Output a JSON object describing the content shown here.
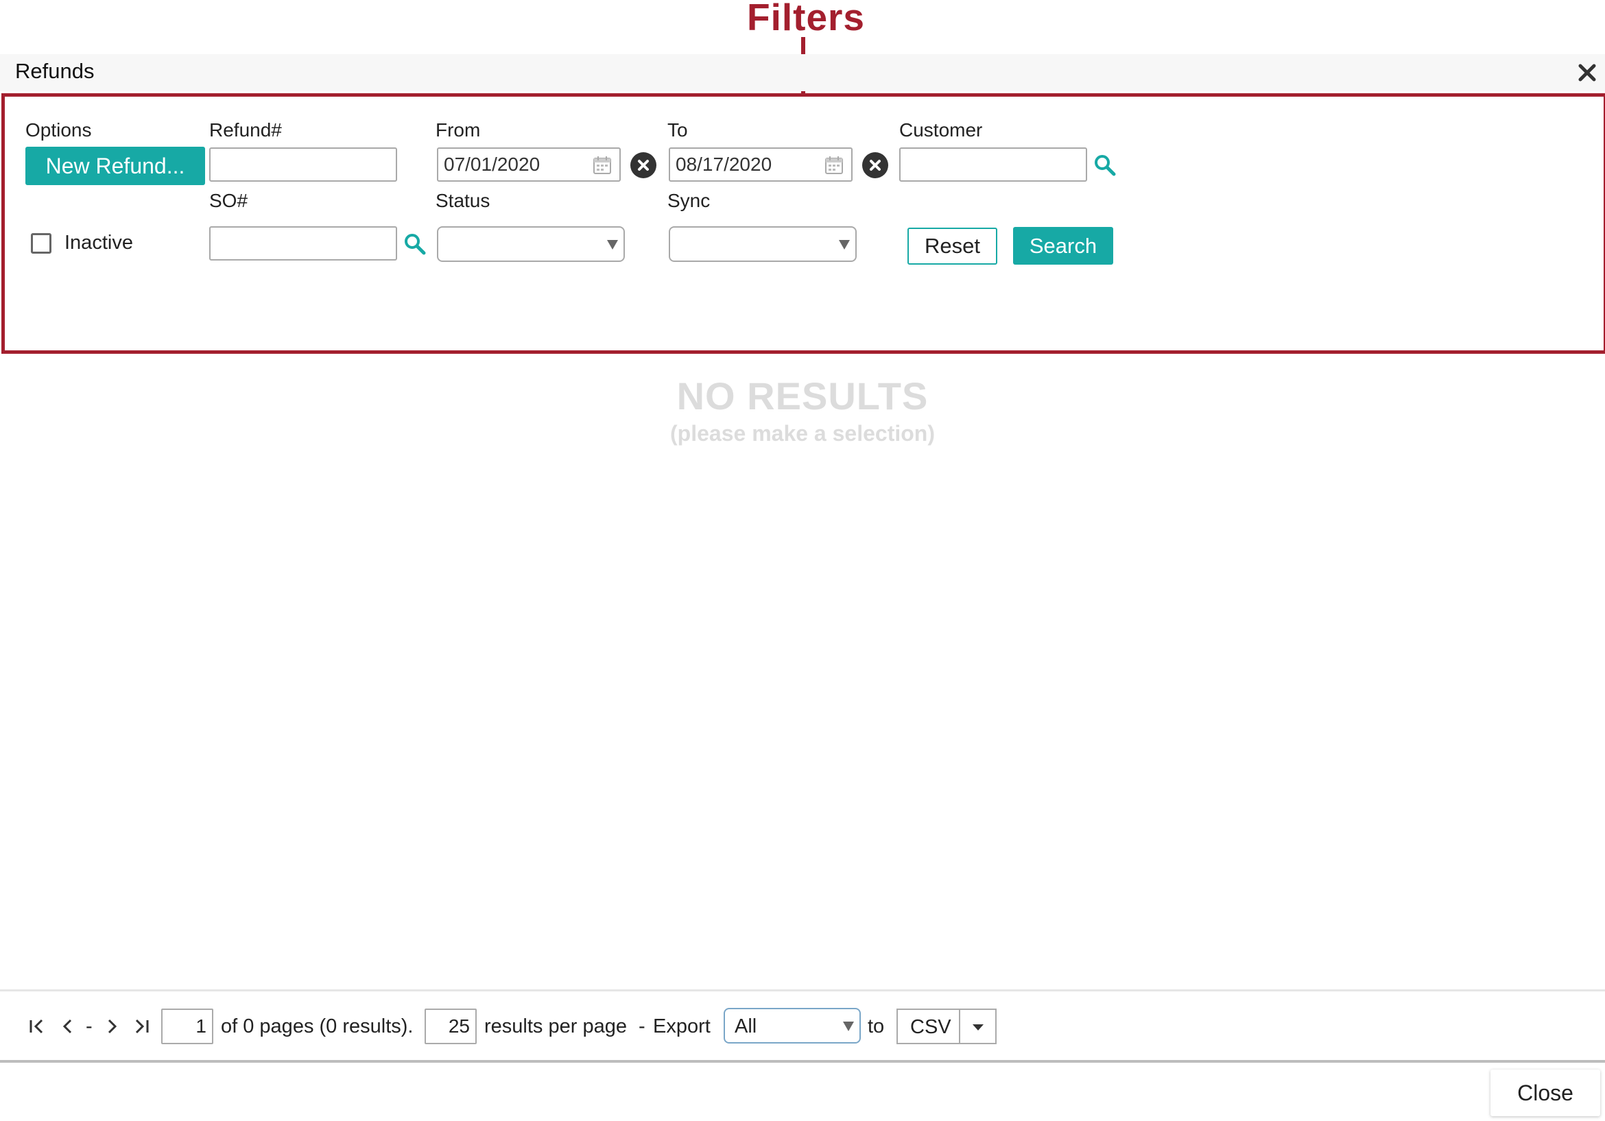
{
  "annotation": {
    "label": "Filters",
    "color": "#a31f2e"
  },
  "dialog": {
    "title": "Refunds"
  },
  "filters": {
    "options_label": "Options",
    "new_refund_label": "New Refund...",
    "refund_no_label": "Refund#",
    "refund_no_value": "",
    "from_label": "From",
    "from_value": "07/01/2020",
    "to_label": "To",
    "to_value": "08/17/2020",
    "customer_label": "Customer",
    "customer_value": "",
    "inactive_label": "Inactive",
    "inactive_checked": false,
    "so_no_label": "SO#",
    "so_no_value": "",
    "status_label": "Status",
    "status_value": "",
    "sync_label": "Sync",
    "sync_value": "",
    "reset_label": "Reset",
    "search_label": "Search"
  },
  "results": {
    "empty_title": "NO RESULTS",
    "empty_subtitle": "(please make a selection)"
  },
  "pager": {
    "separator": "-",
    "page_value": "1",
    "pages_text": "of 0 pages (0 results).",
    "per_page_value": "25",
    "per_page_text": "results per page",
    "dash": "-",
    "export_label": "Export",
    "export_scope": "All",
    "to_label": "to",
    "export_format": "CSV"
  },
  "footer": {
    "close_label": "Close"
  },
  "colors": {
    "accent": "#17a9a5",
    "annotation": "#a31f2e"
  }
}
